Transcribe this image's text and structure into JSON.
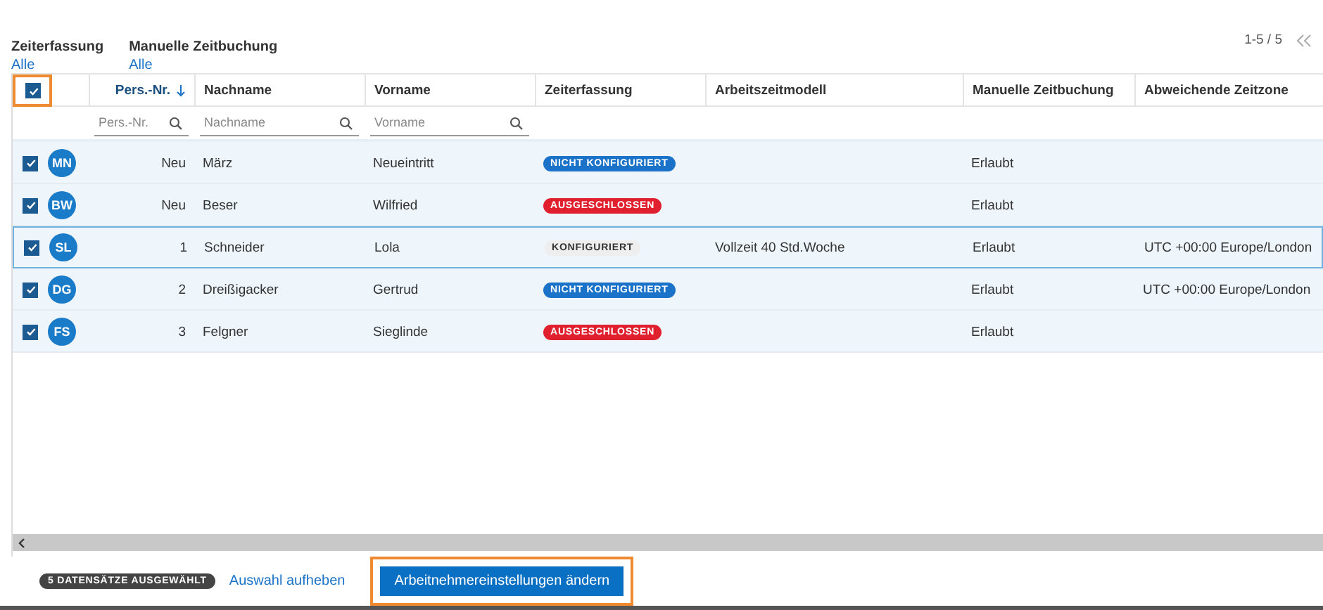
{
  "filters": [
    {
      "label": "Zeiterfassung",
      "value": "Alle"
    },
    {
      "label": "Manuelle Zeitbuchung",
      "value": "Alle"
    }
  ],
  "pagination": {
    "range": "1-5 / 5"
  },
  "table": {
    "select_all": {
      "checked": true,
      "highlighted": true
    },
    "columns": [
      {
        "label": "Pers.-Nr.",
        "sorted": true,
        "placeholder": "Pers.-Nr."
      },
      {
        "label": "Nachname",
        "sorted": false,
        "placeholder": "Nachname"
      },
      {
        "label": "Vorname",
        "sorted": false,
        "placeholder": "Vorname"
      },
      {
        "label": "Zeiterfassung",
        "sorted": false
      },
      {
        "label": "Arbeitszeitmodell",
        "sorted": false
      },
      {
        "label": "Manuelle Zeitbuchung",
        "sorted": false
      },
      {
        "label": "Abweichende Zeitzone",
        "sorted": false
      }
    ],
    "rows": [
      {
        "checked": true,
        "focused": false,
        "initials": "MN",
        "cells": [
          "Neu",
          "März",
          "Neueintritt",
          {
            "status": "NICHT KONFIGURIERT",
            "kind": "info"
          },
          "",
          "Erlaubt",
          ""
        ]
      },
      {
        "checked": true,
        "focused": false,
        "initials": "BW",
        "cells": [
          "Neu",
          "Beser",
          "Wilfried",
          {
            "status": "AUSGESCHLOSSEN",
            "kind": "error"
          },
          "",
          "Erlaubt",
          ""
        ]
      },
      {
        "checked": true,
        "focused": true,
        "initials": "SL",
        "cells": [
          "1",
          "Schneider",
          "Lola",
          {
            "status": "KONFIGURIERT",
            "kind": "neutral"
          },
          "Vollzeit 40 Std.Woche",
          "Erlaubt",
          "UTC +00:00 Europe/London"
        ]
      },
      {
        "checked": true,
        "focused": false,
        "initials": "DG",
        "cells": [
          "2",
          "Dreißigacker",
          "Gertrud",
          {
            "status": "NICHT KONFIGURIERT",
            "kind": "info"
          },
          "",
          "Erlaubt",
          "UTC +00:00 Europe/London"
        ]
      },
      {
        "checked": true,
        "focused": false,
        "initials": "FS",
        "cells": [
          "3",
          "Felgner",
          "Sieglinde",
          {
            "status": "AUSGESCHLOSSEN",
            "kind": "error"
          },
          "",
          "Erlaubt",
          ""
        ]
      }
    ]
  },
  "footer": {
    "selection_badge": "5 DATENSÄTZE AUSGEWÄHLT",
    "clear_link": "Auswahl aufheben",
    "action_button": {
      "label": "Arbeitnehmereinstellungen ändern",
      "highlighted": true
    }
  }
}
